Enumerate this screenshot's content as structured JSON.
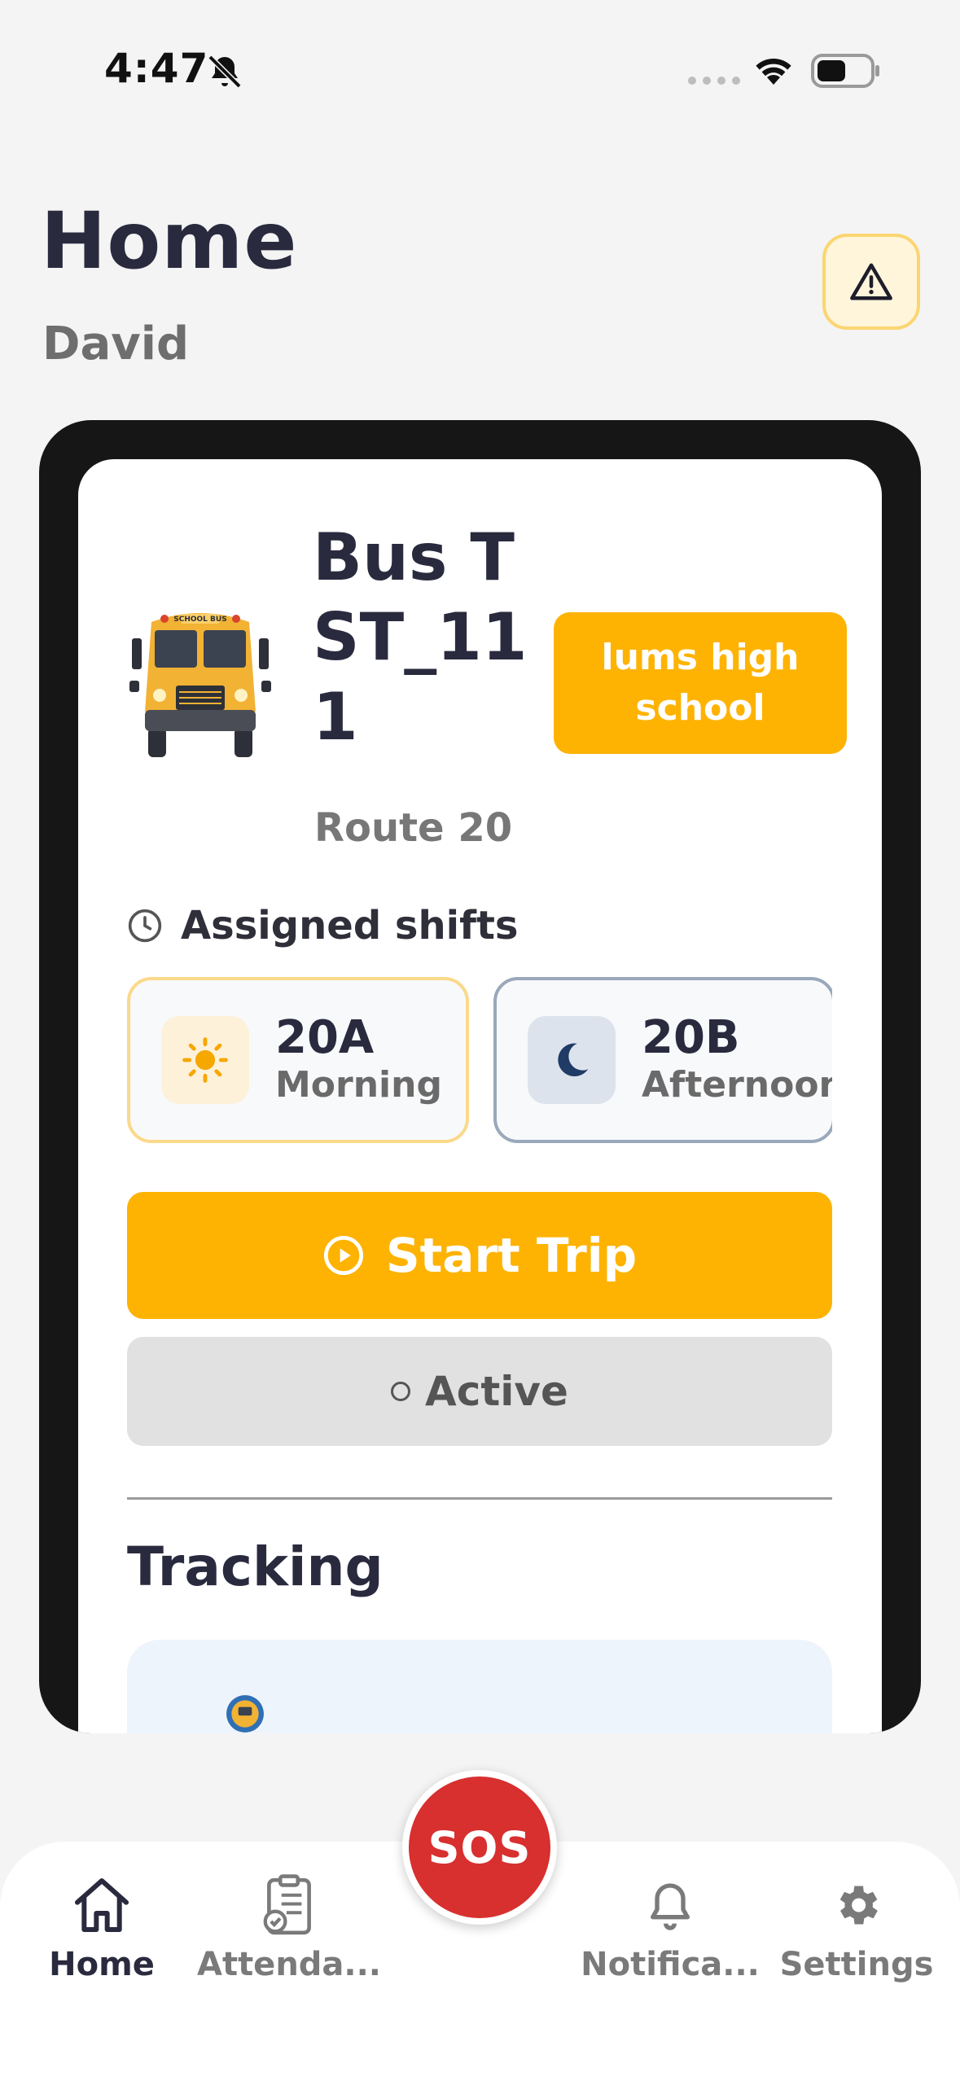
{
  "status_bar": {
    "time": "4:47"
  },
  "header": {
    "title": "Home",
    "user_name": "David"
  },
  "bus": {
    "title": "Bus TST_111",
    "route": "Route 20",
    "school": "lums high school"
  },
  "shifts": {
    "label": "Assigned shifts",
    "items": [
      {
        "code": "20A",
        "name": "Morning",
        "icon": "sun-icon"
      },
      {
        "code": "20B",
        "name": "Afternoon",
        "icon": "moon-icon"
      }
    ]
  },
  "actions": {
    "start_trip": "Start Trip",
    "status": "Active"
  },
  "tracking": {
    "title": "Tracking"
  },
  "sos": {
    "label": "SOS"
  },
  "nav": {
    "items": [
      {
        "label": "Home",
        "icon": "home-icon"
      },
      {
        "label": "Attenda...",
        "icon": "attendance-icon"
      },
      {
        "label": "Notifica...",
        "icon": "bell-icon"
      },
      {
        "label": "Settings",
        "icon": "gear-icon"
      }
    ]
  },
  "colors": {
    "accent": "#feb303",
    "sos": "#d82f2f",
    "text_dark": "#2a2a3f",
    "text_muted": "#6e6e6e",
    "frame": "#161616"
  }
}
